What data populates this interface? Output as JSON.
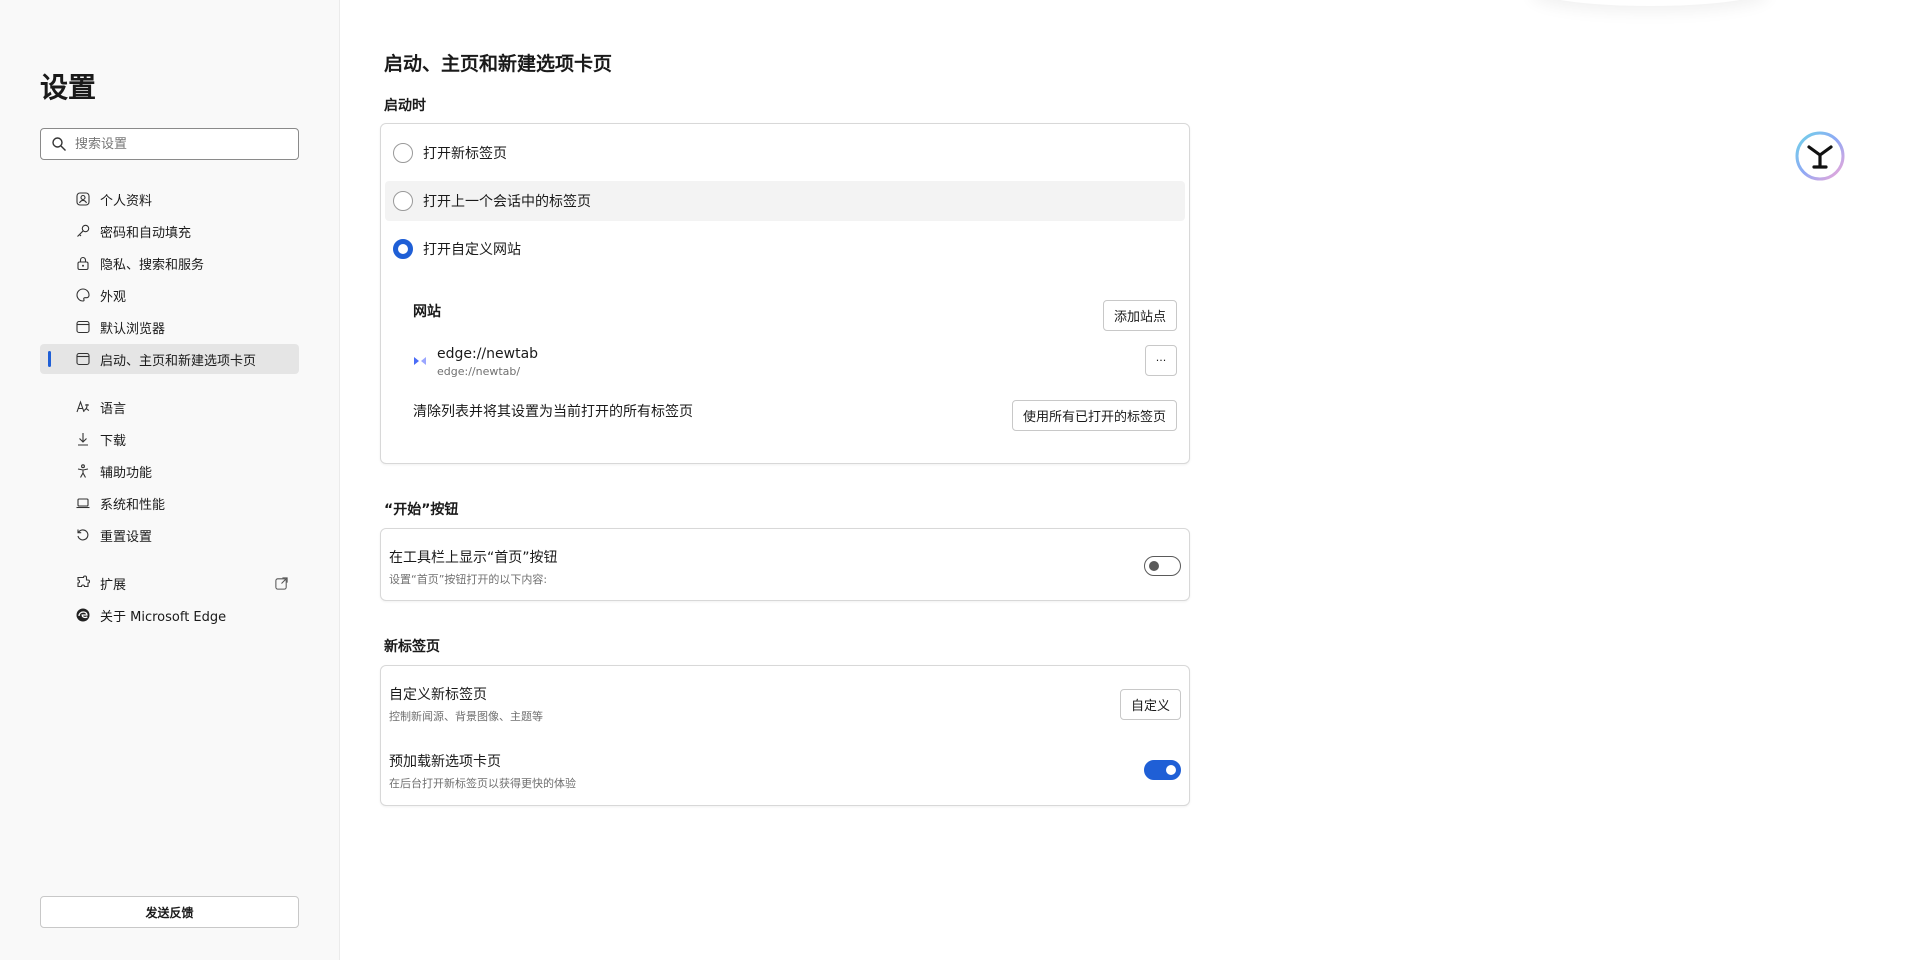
{
  "sidebar": {
    "title": "设置",
    "search_placeholder": "搜索设置",
    "items": [
      {
        "label": "个人资料",
        "icon": "profile-icon"
      },
      {
        "label": "密码和自动填充",
        "icon": "key-icon"
      },
      {
        "label": "隐私、搜索和服务",
        "icon": "lock-icon"
      },
      {
        "label": "外观",
        "icon": "palette-icon"
      },
      {
        "label": "默认浏览器",
        "icon": "browser-icon"
      },
      {
        "label": "启动、主页和新建选项卡页",
        "icon": "home-tabs-icon",
        "active": true
      },
      {
        "label": "语言",
        "icon": "language-icon"
      },
      {
        "label": "下载",
        "icon": "download-icon"
      },
      {
        "label": "辅助功能",
        "icon": "accessibility-icon"
      },
      {
        "label": "系统和性能",
        "icon": "laptop-icon"
      },
      {
        "label": "重置设置",
        "icon": "reset-icon"
      },
      {
        "label": "扩展",
        "icon": "extensions-icon"
      },
      {
        "label": "关于 Microsoft Edge",
        "icon": "edge-logo-icon"
      }
    ],
    "feedback_label": "发送反馈"
  },
  "main": {
    "page_title": "启动、主页和新建选项卡页",
    "startup": {
      "label": "启动时",
      "options": [
        {
          "label": "打开新标签页",
          "checked": false
        },
        {
          "label": "打开上一个会话中的标签页",
          "checked": false
        },
        {
          "label": "打开自定义网站",
          "checked": true
        }
      ],
      "sites_label": "网站",
      "add_site_label": "添加站点",
      "site": {
        "name": "edge://newtab",
        "url": "edge://newtab/"
      },
      "more_label": "···",
      "clear_text": "清除列表并将其设置为当前打开的所有标签页",
      "use_open_tabs_label": "使用所有已打开的标签页"
    },
    "home_button": {
      "label": "“开始”按钮",
      "title": "在工具栏上显示“首页”按钮",
      "subtitle": "设置“首页”按钮打开的以下内容:",
      "enabled": false
    },
    "new_tab": {
      "label": "新标签页",
      "customize_title": "自定义新标签页",
      "customize_subtitle": "控制新闻源、背景图像、主题等",
      "customize_button": "自定义",
      "preload_title": "预加载新选项卡页",
      "preload_subtitle": "在后台打开新标签页以获得更快的体验",
      "preload_enabled": true
    }
  },
  "colors": {
    "accent": "#1f5fd6"
  }
}
